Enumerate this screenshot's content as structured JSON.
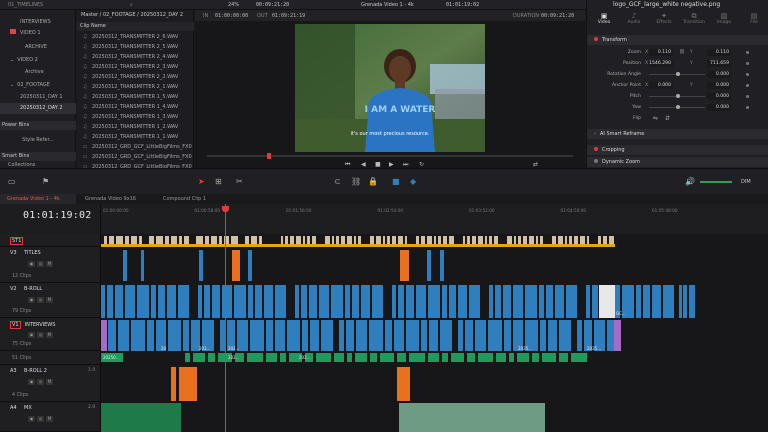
{
  "topbar": {
    "zoom": "24%",
    "source_timecode": "00:09:21:20",
    "timeline_name": "Grenada Video 1 - 4k",
    "record_timecode": "01:01:19:02",
    "inspector_clip": "logo_GCF_large_white negative.png"
  },
  "bins": {
    "timelines": "01_TIMELINES",
    "items": [
      "INTERVIEWS",
      "VIDEO 1",
      "ARCHIVE",
      "VIDEO 2",
      "Archive",
      "02_FOOTAGE",
      "20250311_DAY 1",
      "20250312_DAY 2"
    ],
    "selected_index": 7,
    "power_bins": "Power Bins",
    "power_items": [
      "Style Refer..."
    ],
    "smart_bins": "Smart Bins",
    "smart_items": [
      "Collections"
    ]
  },
  "cliplist": {
    "path": "Master / 02_FOOTAGE / 20250312_DAY 2",
    "header": "Clip Name",
    "clips": [
      {
        "name": "20250312_TRANSMITTER 2_6.WAV",
        "kind": "audio"
      },
      {
        "name": "20250312_TRANSMITTER 2_5.WAV",
        "kind": "audio"
      },
      {
        "name": "20250312_TRANSMITTER 2_4.WAV",
        "kind": "audio"
      },
      {
        "name": "20250312_TRANSMITTER 2_3.WAV",
        "kind": "audio"
      },
      {
        "name": "20250312_TRANSMITTER 2_2.WAV",
        "kind": "audio"
      },
      {
        "name": "20250312_TRANSMITTER 2_1.WAV",
        "kind": "audio"
      },
      {
        "name": "20250312_TRANSMITTER 1_5.WAV",
        "kind": "audio"
      },
      {
        "name": "20250312_TRANSMITTER 1_4.WAV",
        "kind": "audio"
      },
      {
        "name": "20250312_TRANSMITTER 1_3.WAV",
        "kind": "audio"
      },
      {
        "name": "20250312_TRANSMITTER 1_2.WAV",
        "kind": "audio"
      },
      {
        "name": "20250312_TRANSMITTER 1_1.WAV",
        "kind": "audio"
      },
      {
        "name": "20250312_GRD_GCF_LittleBigFilms_FX0",
        "kind": "video"
      },
      {
        "name": "20250312_GRD_GCF_LittleBigFilms_FX0",
        "kind": "video"
      },
      {
        "name": "20250312_GRD_GCF_LittleBigFilms_FX0",
        "kind": "video"
      },
      {
        "name": "20250312_GRD_GCF_LittleBigFilms_FX0",
        "kind": "video"
      }
    ]
  },
  "viewer": {
    "in_label": "IN",
    "in_tc": "01:00:00:00",
    "out_label": "OUT",
    "out_tc": "01:09:21:19",
    "duration_label": "DURATION",
    "duration_tc": "00:09:21:20",
    "subtitle": "it's our most precious resource.",
    "shirt_text": "I AM A WATER"
  },
  "inspector": {
    "tabs": [
      {
        "label": "Video",
        "icon": "video-icon",
        "active": true
      },
      {
        "label": "Audio",
        "icon": "audio-icon",
        "active": false
      },
      {
        "label": "Effects",
        "icon": "effects-icon",
        "active": false
      },
      {
        "label": "Transition",
        "icon": "transition-icon",
        "active": false
      },
      {
        "label": "Image",
        "icon": "image-icon",
        "active": false
      },
      {
        "label": "File",
        "icon": "file-icon",
        "active": false
      }
    ],
    "transform": "Transform",
    "zoom_label": "Zoom",
    "zoom_x_axis": "X",
    "zoom_x": "0.110",
    "zoom_y_axis": "Y",
    "zoom_y": "0.110",
    "position_label": "Position",
    "position_x_axis": "X",
    "position_x": "1546.290",
    "position_y_axis": "Y",
    "position_y": "711.659",
    "rows": [
      {
        "label": "Rotation Angle",
        "value": "0.000",
        "knob": 0.52
      },
      {
        "label": "Anchor Point",
        "value": "0.000",
        "knob": 0.35
      },
      {
        "label": "Pitch",
        "value": "0.000",
        "knob": 0.52
      },
      {
        "label": "Yaw",
        "value": "0.000",
        "knob": 0.52
      },
      {
        "label": "Flip",
        "value": "",
        "knob": null
      }
    ],
    "anchor_x_axis": "X",
    "anchor_x": "0.000",
    "anchor_y_axis": "Y",
    "smart_reframe": "AI Smart Reframe",
    "cropping": "Cropping",
    "dynamic_zoom": "Dynamic Zoom"
  },
  "toolbar": {
    "dim": "DIM"
  },
  "timeline_tabs": [
    "Grenada Video 1 - 4k",
    "Grenada Video 9x16",
    "Compound Clip 1"
  ],
  "timeline": {
    "timecode": "01:01:19:02",
    "ruler": [
      "01:00:00:00",
      "01:00:58:00",
      "01:01:56:00",
      "01:02:54:00",
      "01:03:52:00",
      "01:04:50:00",
      "01:05:48:00"
    ],
    "tracks": [
      {
        "id": "ST1",
        "name": "",
        "count": "",
        "color": "#d9c9a6"
      },
      {
        "id": "V3",
        "name": "TITLES",
        "count": "12 Clips",
        "color": "#e8701f"
      },
      {
        "id": "V2",
        "name": "B-ROLL",
        "count": "79 Clips",
        "color": "#2f7fbf"
      },
      {
        "id": "V1",
        "name": "INTERVIEWS",
        "count": "75 Clips",
        "color": "#2f7fbf"
      },
      {
        "id": "",
        "name": "",
        "count": "51 Clips",
        "color": "#1f9a5a"
      },
      {
        "id": "A3",
        "name": "B-ROLL 2",
        "count": "4 Clips",
        "level": "1.0",
        "color": "#e8701f"
      },
      {
        "id": "A4",
        "name": "MX",
        "count": "",
        "level": "2.0",
        "color": "#1f8a52"
      }
    ],
    "clip_labels": {
      "v1": [
        "20",
        "202...",
        "2025...",
        "2025..."
      ],
      "a2": [
        "20250...",
        "202...",
        "2025...",
        "202..."
      ],
      "v2": [
        "GC..."
      ]
    }
  },
  "colors": {
    "accent": "#e03b3b",
    "orange": "#e8701f",
    "blue": "#2f7fbf",
    "green": "#1f9a5a",
    "yellow": "#e8a417"
  }
}
